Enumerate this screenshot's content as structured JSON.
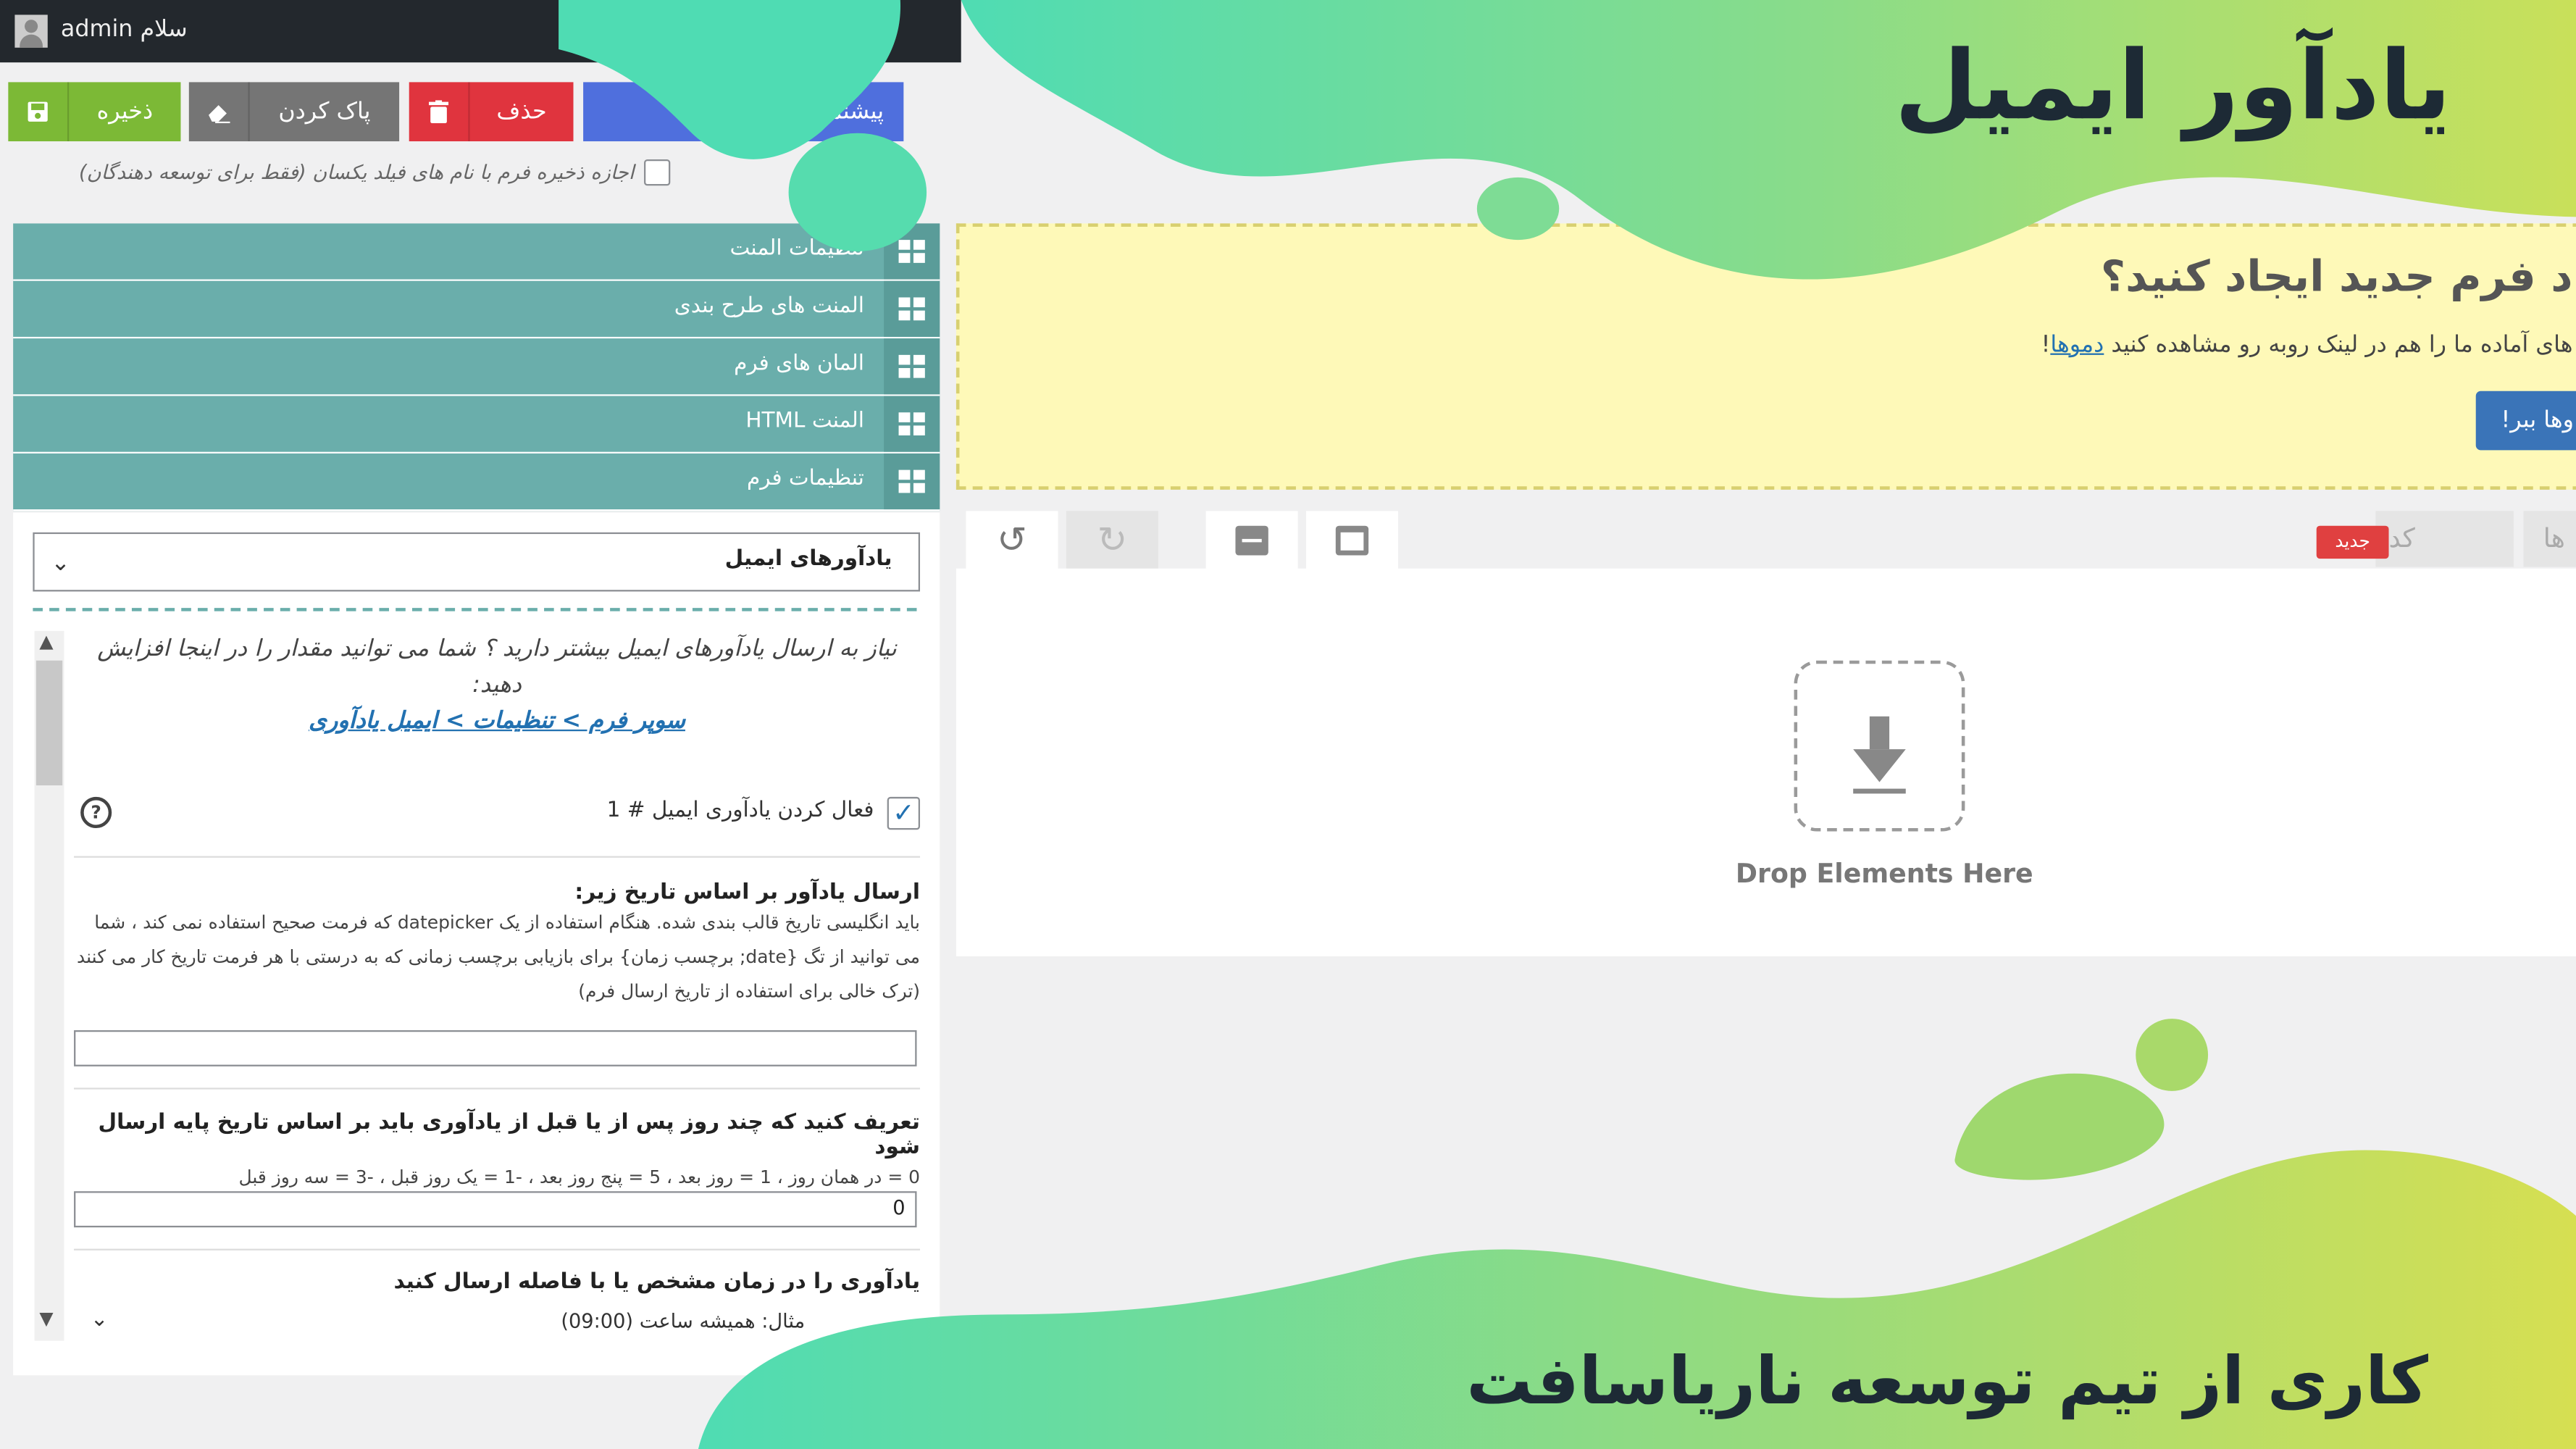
{
  "admin_bar": {
    "greeting": "سلام admin"
  },
  "toolbar": {
    "save_label": "ذخیره",
    "clear_label": "پاک کردن",
    "delete_label": "حذف",
    "preview_label": "پیشنمایش"
  },
  "allow_duplicate_label": "اجازه ذخیره فرم با نام های فیلد یکسان (فقط برای توسعه دهندگان)",
  "accordion": [
    {
      "label": "تنظیمات المنت"
    },
    {
      "label": "المنت های طرح بندی"
    },
    {
      "label": "المان های فرم"
    },
    {
      "label": "المنت HTML"
    },
    {
      "label": "تنظیمات فرم"
    }
  ],
  "settings": {
    "section_select": "یادآورهای ایمیل",
    "note_text": "نیاز به ارسال یادآورهای ایمیل بیشتر دارید ؟ شما می توانید مقدار را در اینجا افزایش دهید:",
    "note_link": "سوپر فرم > تنظیمات > ایمیل یادآوری",
    "enable_label": "فعال کردن یادآوری ایمیل # 1",
    "date_title": "ارسال یادآور بر اساس تاریخ زیر:",
    "date_desc": "باید انگلیسی تاریخ قالب بندی شده. هنگام استفاده از یک datepicker که فرمت صحیح استفاده نمی کند ، شما می توانید از تگ {date; برچسب زمان} برای بازیابی برچسب زمانی که به درستی با هر فرمت تاریخ کار می کنند (ترک خالی برای استفاده از تاریخ ارسال فرم)",
    "date_value": "",
    "days_title": "تعریف کنید که چند روز پس از یا قبل از یادآوری باید بر اساس تاریخ پایه ارسال شود",
    "days_desc": "0 = در همان روز ، 1 = روز بعد ، 5 = پنج روز بعد ، -1 = یک روز قبل ، -3 = سه روز قبل",
    "days_value": "0",
    "time_title": "یادآوری را در زمان مشخص یا با فاصله ارسال کنید",
    "time_select": "مثال: همیشه ساعت (09:00)"
  },
  "notice": {
    "title": "د فرم جدید ایجاد کنید؟",
    "desc_prefix": "های آماده ما را هم در لینک روبه رو مشاهده کنید",
    "desc_link": "دموها",
    "desc_suffix": "!",
    "button": "وها ببر!"
  },
  "builder": {
    "new_badge": "جدید",
    "code_tab": "کد",
    "elements_tab": "ها",
    "drop_text": "Drop Elements Here"
  },
  "overlay": {
    "headline": "یادآور ایمیل",
    "footer": "کاری از تیم توسعه ناریاسافت"
  },
  "colors": {
    "accordion": "#6aaeab",
    "save": "#7cb936",
    "clear": "#757575",
    "delete": "#e0343e",
    "preview": "#4f6fdd"
  },
  "icons": [
    "user-icon",
    "save-icon",
    "eraser-icon",
    "trash-icon",
    "grid-icon",
    "chevron-down-icon",
    "help-icon",
    "undo-icon",
    "redo-icon",
    "minimize-icon",
    "maximize-icon",
    "download-arrow-icon"
  ]
}
